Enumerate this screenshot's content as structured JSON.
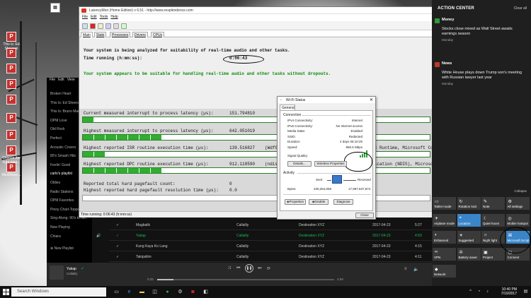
{
  "desktop": {
    "icons": [
      {
        "label": "",
        "type": "doc"
      },
      {
        "label": "This is: Ed Sheeran",
        "type": "pdf"
      },
      {
        "label": "",
        "type": "pdf"
      },
      {
        "label": "",
        "type": "pdf"
      },
      {
        "label": "",
        "type": "pdf"
      },
      {
        "label": "",
        "type": "pdf"
      },
      {
        "label": "",
        "type": "pdf"
      },
      {
        "label": "",
        "type": "pdf"
      },
      {
        "label": "Choose the right data...",
        "type": "pdf"
      },
      {
        "label": "MedWave...",
        "type": "pdf"
      }
    ]
  },
  "spotify": {
    "menu": [
      "File",
      "Edit",
      "View"
    ],
    "playlists": [
      "Broken Heart",
      "This Is: Ed Sheeran",
      "This Is: Bruno Mars",
      "OPM Love",
      "Old Rock",
      "Perfect",
      "Acoustic Covers",
      "80's Smash Hits",
      "Feelin' Good",
      "carlo's playlist",
      "Oldies",
      "Radio Stations",
      "OPM Favorites",
      "Pinoy Chart-Toppers",
      "Sing-Along: 90's to No...",
      "Now Playing",
      "Chiara"
    ],
    "new_playlist": "New Playlist",
    "tracks": [
      {
        "title": "Magbalik",
        "artist": "Callalily",
        "album": "Destination XYZ",
        "date": "2017-04-23",
        "duration": "5:27"
      },
      {
        "title": "Yakap",
        "artist": "Callalily",
        "album": "Destination XYZ",
        "date": "2017-04-23",
        "duration": "4:59"
      },
      {
        "title": "Kung Kaya Ko Lang",
        "artist": "Callalily",
        "album": "Destination XYZ",
        "date": "2017-04-23",
        "duration": "4:15"
      },
      {
        "title": "Takipsilim",
        "artist": "Callalily",
        "album": "Destination XYZ",
        "date": "2017-04-23",
        "duration": "4:11"
      }
    ],
    "now_playing": {
      "title": "Yakap",
      "artist": "Callalily",
      "elapsed": "0:25",
      "total": "4:59",
      "progress": 0.09
    }
  },
  "latencymon": {
    "title": "LatencyMon (Home Edition) v 6.51 - http://www.resplendence.com",
    "menu": [
      "File",
      "Edit",
      "Tools",
      "Help"
    ],
    "tabs": [
      "Main",
      "Stats",
      "Processes",
      "Drivers",
      "CPUs"
    ],
    "analyzing": "Your system is being analyzed for suitability of real-time audio and other tasks.",
    "time_label": "Time running (h:mm:ss):",
    "time_value": "0:06:43",
    "verdict": "Your system appears to be suitable for handling real-time audio and other tasks without dropouts.",
    "metrics": [
      {
        "label": "Current measured interrupt to process latency (µs):",
        "value": "151.794810",
        "detail": "",
        "level": 0.01
      },
      {
        "label": "Highest measured interrupt to process latency (µs):",
        "value": "642.051019",
        "detail": "",
        "level": 0.23
      },
      {
        "label": "Highest reported ISR routine execution time (µs):",
        "value": "139.516827",
        "detail": "(Wdf01000.sys - Kernel Mode Driver Framework Runtime, Microsoft Corporation",
        "level": 0.05
      },
      {
        "label": "Highest reported DPC routine execution time (µs):",
        "value": "912.118590",
        "detail": "(ndis.sys - Network Driver Interface Specification (NDIS), Microsoft Corporation",
        "level": 0.24
      }
    ],
    "pagefault_total": {
      "label": "Reported total hard pagefault count:",
      "value": "0"
    },
    "pagefault_highest": {
      "label": "Highest reported hard pagefault resolution time (µs):",
      "value": "0.0"
    },
    "status": "Time running: 0:06:43 (h:mm:ss)"
  },
  "wifi": {
    "title": "Wi-Fi Status",
    "tab": "General",
    "connection_group": "Connection",
    "rows": [
      {
        "label": "IPv4 Connectivity:",
        "value": "Internet"
      },
      {
        "label": "IPv6 Connectivity:",
        "value": "No Internet access"
      },
      {
        "label": "Media State:",
        "value": "Enabled"
      },
      {
        "label": "SSID:",
        "value": "Redacted"
      },
      {
        "label": "Duration:",
        "value": "4 days 05:10:25"
      },
      {
        "label": "Speed:",
        "value": "866.5 Mbps"
      }
    ],
    "signal_label": "Signal Quality:",
    "details_button": "Details...",
    "wireless_button": "Wireless Properties",
    "activity_group": "Activity",
    "sent_label": "Sent",
    "received_label": "Received",
    "bytes_label": "Bytes:",
    "bytes_sent": "230,264,058",
    "bytes_received": "17,997,637,874",
    "properties_button": "Properties",
    "disable_button": "Disable",
    "diagnose_button": "Diagnose",
    "close_button": "Close"
  },
  "action_center": {
    "title": "ACTION CENTER",
    "clear": "Clear all",
    "notifications": [
      {
        "app": "Money",
        "text": "Stocks close mixed as Wall Street awaits earnings season",
        "time": "Monday",
        "color": "#2e9c3a"
      },
      {
        "app": "News",
        "text": "White House plays down Trump son's meeting with Russian lawyer last year",
        "time": "Monday",
        "color": "#c0392b"
      }
    ],
    "collapse": "Collapse",
    "quick_actions": [
      {
        "label": "Tablet mode",
        "icon": "▭",
        "on": false
      },
      {
        "label": "Rotation lock",
        "icon": "↻",
        "on": false
      },
      {
        "label": "Note",
        "icon": "✎",
        "on": false
      },
      {
        "label": "All settings",
        "icon": "⚙",
        "on": false
      },
      {
        "label": "Airplane mode",
        "icon": "✈",
        "on": false
      },
      {
        "label": "Location",
        "icon": "⌖",
        "on": true
      },
      {
        "label": "Quiet hours",
        "icon": "☾",
        "on": false
      },
      {
        "label": "Mobile hotspot",
        "icon": "◎",
        "on": false
      },
      {
        "label": "Enhanced",
        "icon": "◐",
        "on": false
      },
      {
        "label": "Suggested",
        "icon": "☀",
        "on": false
      },
      {
        "label": "Night light",
        "icon": "☼",
        "on": false
      },
      {
        "label": "Microsoft Script Outside",
        "icon": "⌘",
        "on": true
      },
      {
        "label": "VPN",
        "icon": "∞",
        "on": false
      },
      {
        "label": "Battery saver",
        "icon": "✇",
        "on": false
      },
      {
        "label": "Project",
        "icon": "▣",
        "on": false
      },
      {
        "label": "Connect",
        "icon": "▢",
        "on": false
      },
      {
        "label": "Network",
        "icon": "◆",
        "on": false
      }
    ]
  },
  "taskbar": {
    "search_placeholder": "Search Windows",
    "time": "10:40 PM",
    "date": "7/10/2017"
  }
}
